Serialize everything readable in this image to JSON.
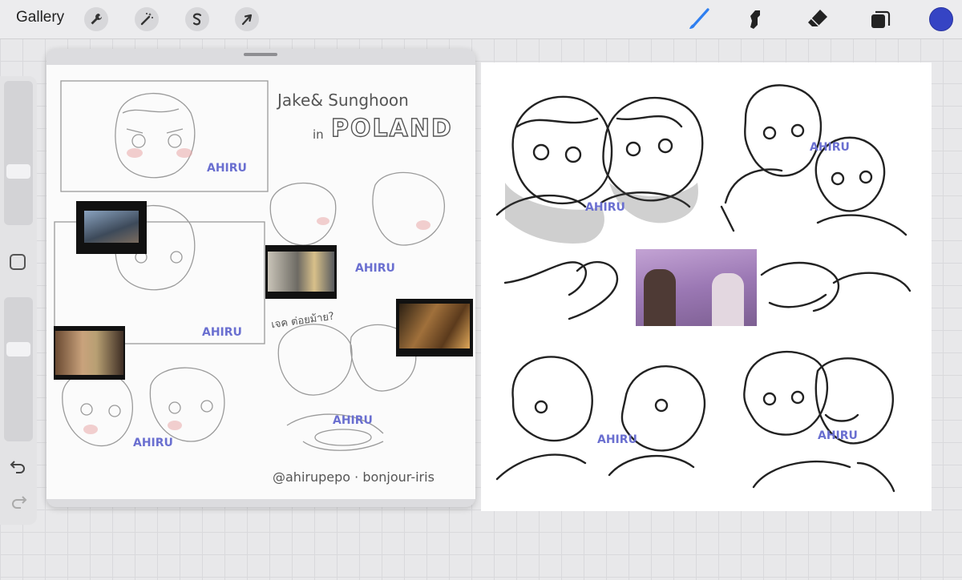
{
  "topbar": {
    "gallery_label": "Gallery",
    "left_tools": [
      "wrench-icon",
      "magic-wand-icon",
      "selection-s-icon",
      "arrow-transform-icon"
    ],
    "right_tools": [
      "brush-icon",
      "smudge-icon",
      "eraser-icon",
      "layers-icon"
    ],
    "active_tool": "brush-icon",
    "current_color": "#3544c4"
  },
  "sidebar": {
    "tools": [
      "brush-size-slider",
      "modify-button",
      "opacity-slider",
      "undo-icon",
      "redo-icon"
    ]
  },
  "reference": {
    "title_line1": "Jake& Sunghoon",
    "title_line2": "in",
    "title_line3": "POLAND",
    "thai_note": "เจค ต่อยม้าย?",
    "credit": "@ahirupepo · bonjour-iris",
    "watermark": "AHIRU PEPO"
  },
  "canvas": {
    "watermark": "AHIRU PEPO"
  }
}
